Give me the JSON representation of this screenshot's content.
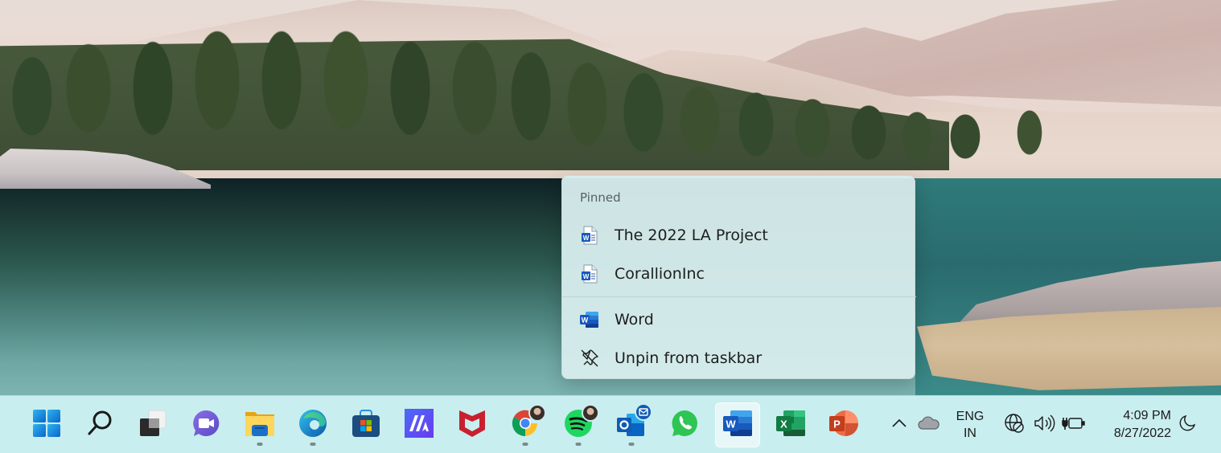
{
  "wallpaper": {
    "description": "Windows 11 landscape: pine forest, sand dunes, teal lake"
  },
  "jumplist": {
    "section_header": "Pinned",
    "pinned": [
      {
        "label": "The 2022 LA Project",
        "icon": "word-document-icon"
      },
      {
        "label": "CorallionInc",
        "icon": "word-document-icon"
      }
    ],
    "actions": [
      {
        "label": "Word",
        "icon": "word-app-icon"
      },
      {
        "label": "Unpin from taskbar",
        "icon": "unpin-icon"
      }
    ]
  },
  "taskbar": {
    "apps": [
      {
        "name": "Start",
        "icon": "windows-start-icon",
        "running": false
      },
      {
        "name": "Search",
        "icon": "search-icon",
        "running": false
      },
      {
        "name": "Task View",
        "icon": "task-view-icon",
        "running": false
      },
      {
        "name": "Chat",
        "icon": "teams-chat-icon",
        "running": false
      },
      {
        "name": "File Explorer",
        "icon": "file-explorer-icon",
        "running": true
      },
      {
        "name": "Microsoft Edge",
        "icon": "edge-icon",
        "running": true
      },
      {
        "name": "Microsoft Store",
        "icon": "store-icon",
        "running": false
      },
      {
        "name": "Microsoft Teams / App",
        "icon": "app-ma-icon",
        "running": false
      },
      {
        "name": "McAfee",
        "icon": "mcafee-icon",
        "running": false
      },
      {
        "name": "Google Chrome",
        "icon": "chrome-icon",
        "running": true,
        "badge": "profile-avatar"
      },
      {
        "name": "Spotify",
        "icon": "spotify-icon",
        "running": true,
        "badge": "profile-avatar"
      },
      {
        "name": "Outlook",
        "icon": "outlook-icon",
        "running": true,
        "badge": "mail"
      },
      {
        "name": "WhatsApp",
        "icon": "whatsapp-icon",
        "running": false
      },
      {
        "name": "Word",
        "icon": "word-icon",
        "running": false,
        "active": true
      },
      {
        "name": "Excel",
        "icon": "excel-icon",
        "running": false
      },
      {
        "name": "PowerPoint",
        "icon": "powerpoint-icon",
        "running": false
      }
    ],
    "tray": {
      "language_line1": "ENG",
      "language_line2": "IN",
      "time": "4:09 PM",
      "date": "8/27/2022"
    }
  },
  "colors": {
    "taskbar_bg": "#c9eeef",
    "menu_bg": "#d6ecec",
    "word_blue": "#185abd",
    "excel_green": "#107c41",
    "powerpoint_red": "#c43e1c"
  }
}
